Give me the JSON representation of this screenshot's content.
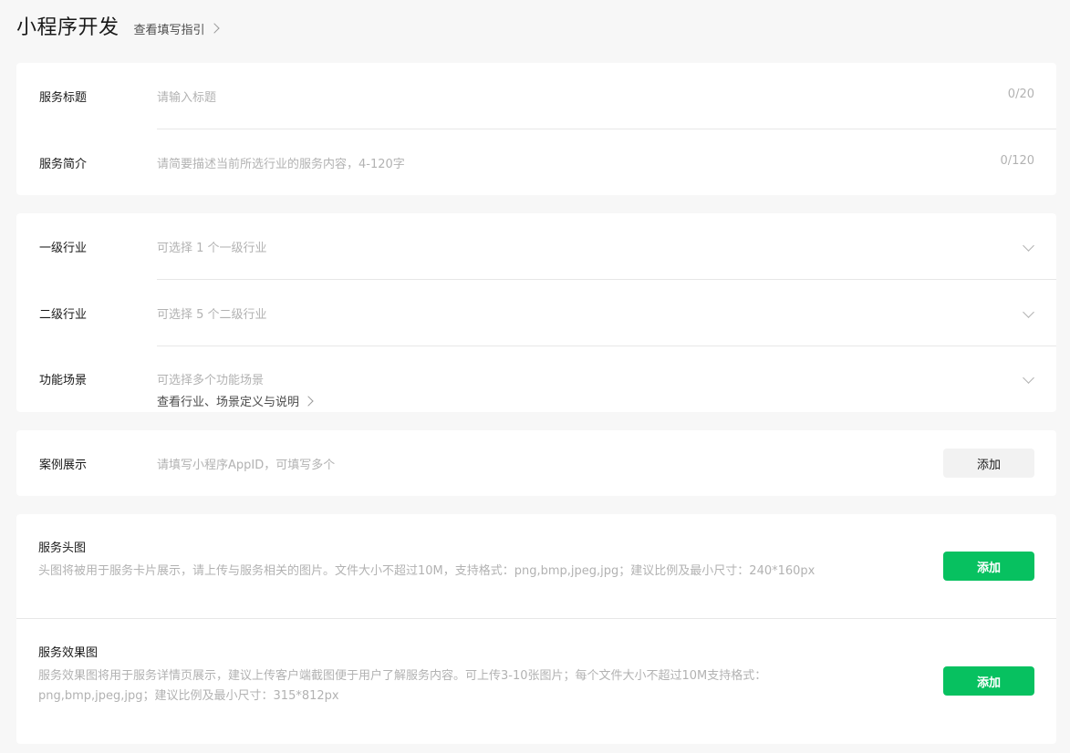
{
  "header": {
    "title": "小程序开发",
    "guide_link": "查看填写指引"
  },
  "service_info": {
    "title_label": "服务标题",
    "title_placeholder": "请输入标题",
    "title_counter": "0/20",
    "intro_label": "服务简介",
    "intro_placeholder": "请简要描述当前所选行业的服务内容，4-120字",
    "intro_counter": "0/120"
  },
  "industry": {
    "level1_label": "一级行业",
    "level1_placeholder": "可选择 1 个一级行业",
    "level2_label": "二级行业",
    "level2_placeholder": "可选择 5 个二级行业",
    "scene_label": "功能场景",
    "scene_placeholder": "可选择多个功能场景",
    "definition_link": "查看行业、场景定义与说明"
  },
  "cases": {
    "label": "案例展示",
    "placeholder": "请填写小程序AppID，可填写多个",
    "add_label": "添加"
  },
  "images": {
    "head_title": "服务头图",
    "head_desc": "头图将被用于服务卡片展示，请上传与服务相关的图片。文件大小不超过10M，支持格式：png,bmp,jpeg,jpg；建议比例及最小尺寸：240*160px",
    "head_add_label": "添加",
    "effect_title": "服务效果图",
    "effect_desc_line1": "服务效果图将用于服务详情页展示，建议上传客户端截图便于用户了解服务内容。可上传3-10张图片；每个文件大小不超过10M支持格式：",
    "effect_desc_line2": "png,bmp,jpeg,jpg；建议比例及最小尺寸：315*812px",
    "effect_add_label": "添加"
  },
  "colors": {
    "accent_green": "#07c160",
    "background": "#f7f7f7",
    "placeholder": "#b2b2b2"
  }
}
